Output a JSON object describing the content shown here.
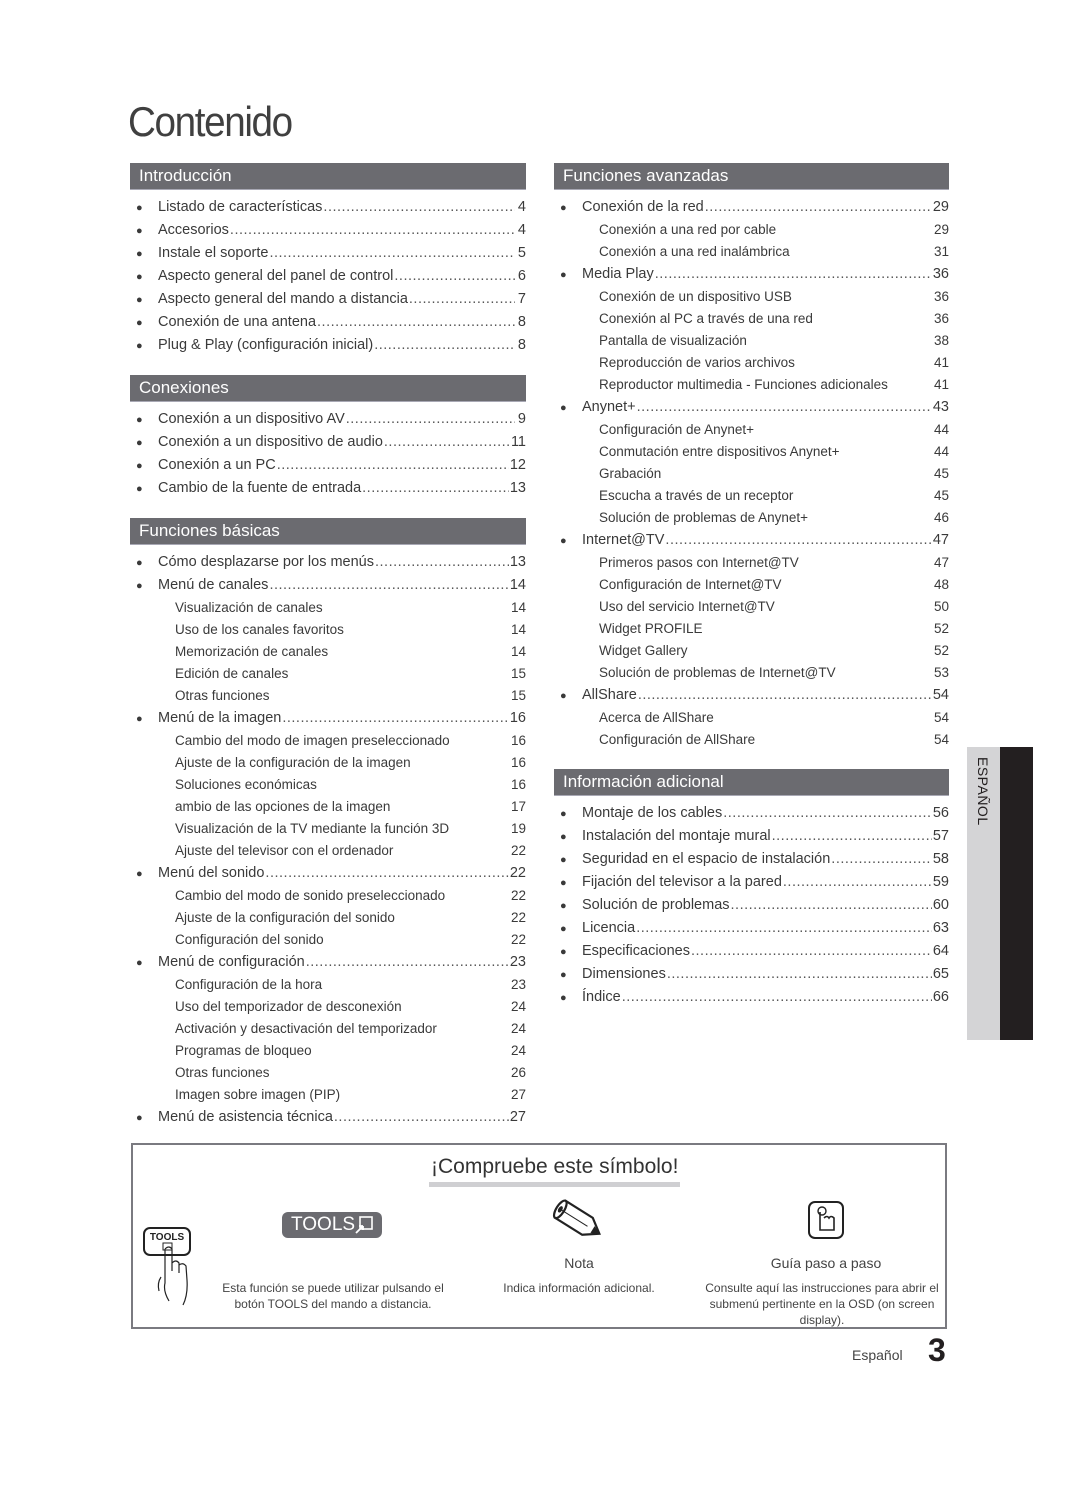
{
  "page": {
    "title": "Contenido",
    "footer_language": "Español",
    "page_number": "3",
    "language_tab": "ESPAÑOL"
  },
  "left_column": [
    {
      "header": "Introducción",
      "entries": [
        {
          "label": "Listado de características",
          "page": "4",
          "subs": []
        },
        {
          "label": "Accesorios",
          "page": "4",
          "subs": []
        },
        {
          "label": "Instale el soporte",
          "page": "5",
          "subs": []
        },
        {
          "label": "Aspecto general del panel de control",
          "page": "6",
          "subs": []
        },
        {
          "label": "Aspecto general del mando a distancia",
          "page": "7",
          "subs": []
        },
        {
          "label": "Conexión de una antena",
          "page": "8",
          "subs": []
        },
        {
          "label": "Plug & Play (configuración inicial)",
          "page": "8",
          "subs": []
        }
      ]
    },
    {
      "header": "Conexiones",
      "entries": [
        {
          "label": "Conexión a un dispositivo AV",
          "page": "9",
          "subs": []
        },
        {
          "label": "Conexión a un dispositivo de audio",
          "page": "11",
          "subs": []
        },
        {
          "label": "Conexión a un PC",
          "page": "12",
          "subs": []
        },
        {
          "label": "Cambio de la fuente de entrada",
          "page": "13",
          "subs": []
        }
      ]
    },
    {
      "header": "Funciones básicas",
      "entries": [
        {
          "label": "Cómo desplazarse por los menús",
          "page": "13",
          "subs": []
        },
        {
          "label": " Menú de canales",
          "page": "14",
          "subs": [
            {
              "label": "Visualización de canales",
              "page": "14"
            },
            {
              "label": "Uso de los canales favoritos",
              "page": "14"
            },
            {
              "label": "Memorización de canales",
              "page": "14"
            },
            {
              "label": "Edición de canales",
              "page": "15"
            },
            {
              "label": "Otras funciones",
              "page": "15"
            }
          ]
        },
        {
          "label": "Menú de la imagen",
          "page": "16",
          "subs": [
            {
              "label": "Cambio del modo de imagen preseleccionado",
              "page": "16"
            },
            {
              "label": "Ajuste de la configuración de la imagen",
              "page": "16"
            },
            {
              "label": "Soluciones económicas",
              "page": "16"
            },
            {
              "label": "ambio de las opciones de la imagen",
              "page": "17"
            },
            {
              "label": "Visualización de la TV mediante la función 3D",
              "page": "19"
            },
            {
              "label": "Ajuste del televisor con el ordenador",
              "page": "22"
            }
          ]
        },
        {
          "label": "Menú del sonido",
          "page": "22",
          "subs": [
            {
              "label": "Cambio del modo de sonido preseleccionado",
              "page": "22"
            },
            {
              "label": "Ajuste de la configuración del sonido",
              "page": "22"
            },
            {
              "label": "Configuración del sonido",
              "page": "22"
            }
          ]
        },
        {
          "label": "Menú de configuración",
          "page": "23",
          "subs": [
            {
              "label": "Configuración de la hora",
              "page": "23"
            },
            {
              "label": "Uso del temporizador de desconexión",
              "page": "24"
            },
            {
              "label": "Activación y desactivación del temporizador",
              "page": "24"
            },
            {
              "label": "Programas de bloqueo",
              "page": "24"
            },
            {
              "label": "Otras funciones",
              "page": "26"
            },
            {
              "label": "Imagen sobre imagen (PIP)",
              "page": "27"
            }
          ]
        },
        {
          "label": "Menú de asistencia técnica",
          "page": "27",
          "subs": []
        }
      ]
    }
  ],
  "right_column": [
    {
      "header": "Funciones avanzadas",
      "entries": [
        {
          "label": "Conexión de la red",
          "page": "29",
          "subs": [
            {
              "label": "Conexión a una red por cable",
              "page": "29"
            },
            {
              "label": "Conexión a una red inalámbrica",
              "page": "31"
            }
          ]
        },
        {
          "label": "Media Play",
          "page": "36",
          "subs": [
            {
              "label": "Conexión de un dispositivo USB",
              "page": "36"
            },
            {
              "label": "Conexión al PC a través de una red",
              "page": "36"
            },
            {
              "label": "Pantalla de visualización",
              "page": "38"
            },
            {
              "label": "Reproducción de varios archivos",
              "page": "41"
            },
            {
              "label": "Reproductor multimedia - Funciones adicionales",
              "page": "41"
            }
          ]
        },
        {
          "label": "Anynet+",
          "page": "43",
          "subs": [
            {
              "label": "Configuración de Anynet+",
              "page": "44"
            },
            {
              "label": "Conmutación entre dispositivos Anynet+",
              "page": "44"
            },
            {
              "label": "Grabación",
              "page": "45"
            },
            {
              "label": "Escucha a través de un receptor",
              "page": "45"
            },
            {
              "label": "Solución de problemas de Anynet+",
              "page": "46"
            }
          ]
        },
        {
          "label": "Internet@TV",
          "page": "47",
          "subs": [
            {
              "label": "Primeros pasos con Internet@TV",
              "page": "47"
            },
            {
              "label": "Configuración de Internet@TV",
              "page": "48"
            },
            {
              "label": "Uso del servicio Internet@TV",
              "page": "50"
            },
            {
              "label": "Widget PROFILE",
              "page": "52"
            },
            {
              "label": "Widget Gallery",
              "page": "52"
            },
            {
              "label": "Solución de problemas de Internet@TV",
              "page": "53"
            }
          ]
        },
        {
          "label": "AllShare",
          "page": "54",
          "subs": [
            {
              "label": "Acerca de AllShare",
              "page": "54"
            },
            {
              "label": "Configuración de AllShare",
              "page": "54"
            }
          ]
        }
      ]
    },
    {
      "header": "Información adicional",
      "entries": [
        {
          "label": "Montaje de los cables",
          "page": "56",
          "subs": []
        },
        {
          "label": "Instalación del montaje mural",
          "page": "57",
          "subs": []
        },
        {
          "label": "Seguridad en el espacio de instalación",
          "page": "58",
          "subs": []
        },
        {
          "label": "Fijación del televisor a la pared",
          "page": "59",
          "subs": []
        },
        {
          "label": "Solución de problemas",
          "page": "60",
          "subs": []
        },
        {
          "label": "Licencia",
          "page": "63",
          "subs": []
        },
        {
          "label": "Especificaciones",
          "page": "64",
          "subs": []
        },
        {
          "label": "Dimensiones",
          "page": "65",
          "subs": []
        },
        {
          "label": "Índice",
          "page": "66",
          "subs": []
        }
      ]
    }
  ],
  "symbols": {
    "title": "¡Compruebe este símbolo!",
    "tools": {
      "badge_label": "TOOLS",
      "hand_label": "TOOLS",
      "description_line1": "Esta función se puede utilizar pulsando el",
      "description_line2": "botón TOOLS del mando a distancia."
    },
    "note": {
      "name": "Nota",
      "description": "Indica información adicional."
    },
    "step_guide": {
      "name": "Guía paso a paso",
      "description_line1": "Consulte aquí las instrucciones para abrir el",
      "description_line2": "submenú pertinente en la OSD (on screen",
      "description_line3": "display)."
    }
  },
  "colors": {
    "header_bar": "#6b6b70",
    "tab_light": "#d4d4d6",
    "tab_dark": "#231f20",
    "text": "#3a3a3a"
  }
}
